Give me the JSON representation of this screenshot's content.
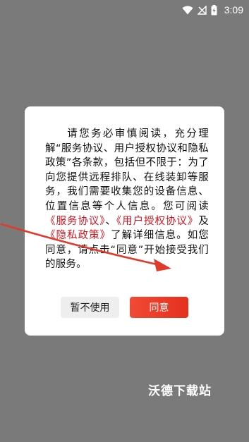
{
  "status_bar": {
    "time": "3:09",
    "icons": [
      "wifi-icon",
      "no-signal-icon",
      "battery-charging-icon"
    ]
  },
  "dialog": {
    "text_intro": "请您务必审慎阅读，充分理解“服务协议、用户授权协议和隐私政策”各条款，包括但不限于：为了向您提供远程排队、在线装卸等服务，我们需要收集您的设备信息、位置信息等个人信息。您可阅读",
    "link_service": "《服务协议》",
    "sep1": "、",
    "link_user_auth": "《用户授权协议》",
    "sep2": "及",
    "link_privacy": "《隐私政策》",
    "text_outro": "了解详细信息。如您同意，请点击“同意”开始接受我们的服务。",
    "decline_button": "暂不使用",
    "agree_button": "同意"
  },
  "watermark": {
    "text": "沃德下载站"
  },
  "colors": {
    "overlay": "#7a7a7a",
    "link": "#d0141f",
    "agree_button": "#e83b2a",
    "arrow": "#e03a2a"
  }
}
